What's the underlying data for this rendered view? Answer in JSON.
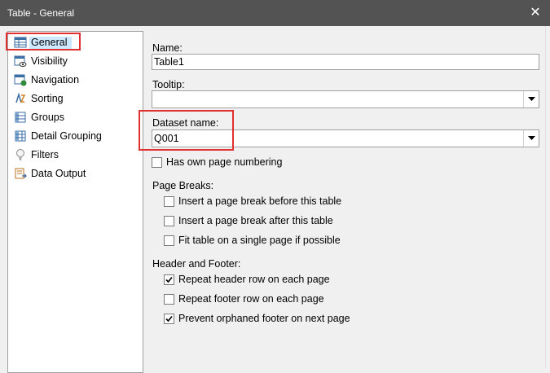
{
  "window": {
    "title": "Table - General",
    "close_glyph": "✕"
  },
  "nav": {
    "items": [
      {
        "label": "General",
        "icon": "table-general-icon",
        "selected": true
      },
      {
        "label": "Visibility",
        "icon": "visibility-icon"
      },
      {
        "label": "Navigation",
        "icon": "navigation-icon"
      },
      {
        "label": "Sorting",
        "icon": "sorting-icon"
      },
      {
        "label": "Groups",
        "icon": "groups-icon"
      },
      {
        "label": "Detail Grouping",
        "icon": "detail-grouping-icon"
      },
      {
        "label": "Filters",
        "icon": "filter-icon"
      },
      {
        "label": "Data Output",
        "icon": "data-output-icon"
      }
    ]
  },
  "form": {
    "name_label": "Name:",
    "name_value": "Table1",
    "tooltip_label": "Tooltip:",
    "tooltip_value": "",
    "dataset_label": "Dataset name:",
    "dataset_value": "Q001",
    "own_page_numbering": {
      "label": "Has own page numbering",
      "checked": false
    },
    "page_breaks_label": "Page Breaks:",
    "page_breaks": [
      {
        "label": "Insert a page break before this table",
        "checked": false
      },
      {
        "label": "Insert a page break after this table",
        "checked": false
      },
      {
        "label": "Fit table on a single page if possible",
        "checked": false
      }
    ],
    "header_footer_label": "Header and Footer:",
    "header_footer": [
      {
        "label": "Repeat header row on each page",
        "checked": true
      },
      {
        "label": "Repeat footer row on each page",
        "checked": false
      },
      {
        "label": "Prevent orphaned footer on next page",
        "checked": true
      }
    ]
  },
  "colors": {
    "highlight_border": "#e03030",
    "selection_bg": "#cce8ff",
    "titlebar_bg": "#535353"
  }
}
